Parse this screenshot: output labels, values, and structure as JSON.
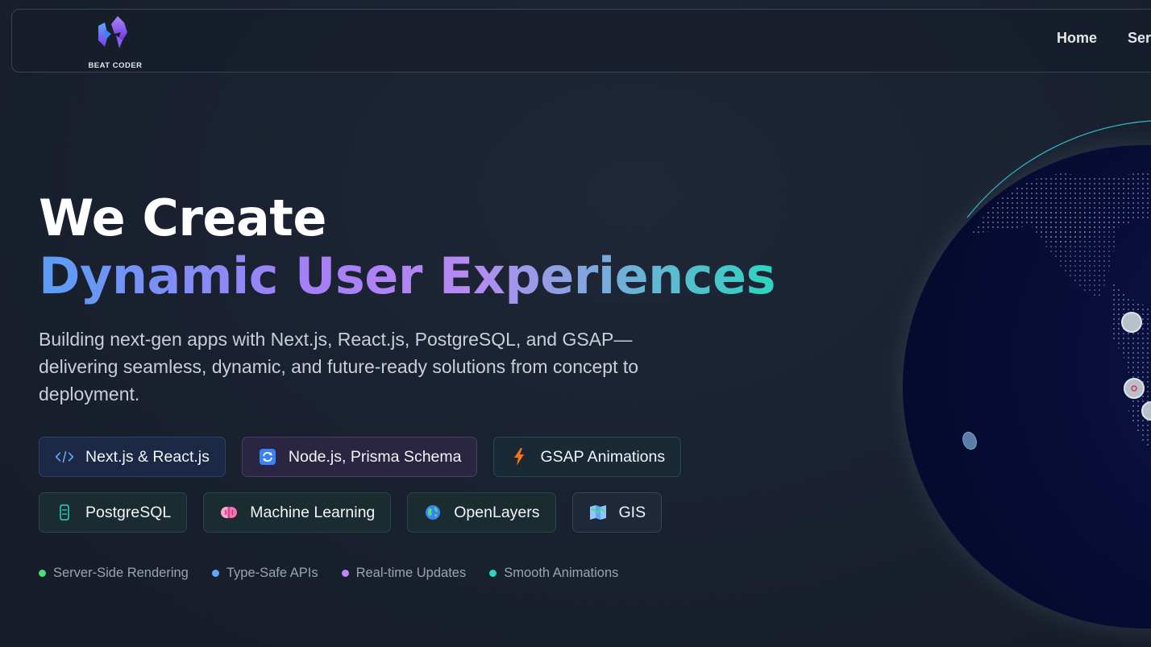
{
  "header": {
    "logo_text": "BEAT CODER",
    "nav": [
      "Home",
      "Services"
    ]
  },
  "hero": {
    "title_line1": "We Create",
    "title_line2": "Dynamic User Experiences",
    "subtitle": "Building next-gen apps with Next.js, React.js, PostgreSQL, and GSAP—delivering seamless, dynamic, and future-ready solutions from concept to deployment."
  },
  "chips": [
    {
      "label": "Next.js & React.js",
      "icon": "code-icon"
    },
    {
      "label": "Node.js, Prisma Schema",
      "icon": "refresh-icon"
    },
    {
      "label": "GSAP Animations",
      "icon": "lightning-icon"
    },
    {
      "label": "PostgreSQL",
      "icon": "database-icon"
    },
    {
      "label": "Machine Learning",
      "icon": "brain-icon"
    },
    {
      "label": "OpenLayers",
      "icon": "globe-icon"
    },
    {
      "label": "GIS",
      "icon": "map-icon"
    }
  ],
  "features": [
    {
      "label": "Server-Side Rendering",
      "color": "#4ade80"
    },
    {
      "label": "Type-Safe APIs",
      "color": "#60a5fa"
    },
    {
      "label": "Real-time Updates",
      "color": "#c084fc"
    },
    {
      "label": "Smooth Animations",
      "color": "#2dd4bf"
    }
  ],
  "colors": {
    "background": "#1a2130",
    "accent_blue": "#5b9df5",
    "accent_purple": "#a77ef7",
    "accent_teal": "#2dd4bf",
    "globe": "#0a0f3a"
  }
}
